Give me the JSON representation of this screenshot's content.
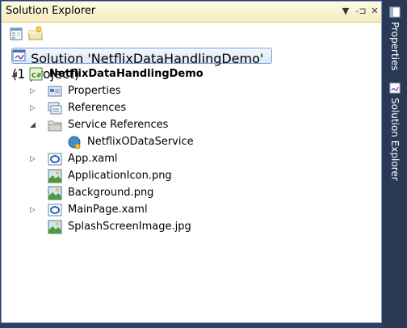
{
  "panel": {
    "title": "Solution Explorer",
    "dropdown_glyph": "▼",
    "pin_glyph": "-⊐",
    "close_glyph": "✕"
  },
  "toolbar": {
    "buttons": [
      {
        "icon": "properties-icon"
      },
      {
        "icon": "show-all-files-icon"
      }
    ]
  },
  "tree": {
    "solution": {
      "label": "Solution 'NetflixDataHandlingDemo' (1 project)",
      "icon": "solution-icon"
    },
    "project": {
      "label": "NetflixDataHandlingDemo",
      "icon": "csharp-project-icon",
      "expanded": true
    },
    "items": [
      {
        "label": "Properties",
        "icon": "properties-folder-icon",
        "expander": "collapsed"
      },
      {
        "label": "References",
        "icon": "references-icon",
        "expander": "collapsed"
      },
      {
        "label": "Service References",
        "icon": "folder-icon",
        "expander": "expanded"
      },
      {
        "label": "NetflixODataService",
        "icon": "web-service-icon",
        "expander": "none"
      },
      {
        "label": "App.xaml",
        "icon": "xaml-file-icon",
        "expander": "collapsed"
      },
      {
        "label": "ApplicationIcon.png",
        "icon": "image-file-icon",
        "expander": "none"
      },
      {
        "label": "Background.png",
        "icon": "image-file-icon",
        "expander": "none"
      },
      {
        "label": "MainPage.xaml",
        "icon": "xaml-file-icon",
        "expander": "collapsed"
      },
      {
        "label": "SplashScreenImage.jpg",
        "icon": "image-file-icon",
        "expander": "none"
      }
    ]
  },
  "side_tabs": [
    {
      "label": "Properties",
      "icon": "properties-tab-icon"
    },
    {
      "label": "Solution Explorer",
      "icon": "solution-explorer-tab-icon"
    }
  ],
  "colors": {
    "side_bar": "#293955",
    "title_bar": "#f5ebbc",
    "selection_border": "#7da2ce"
  }
}
